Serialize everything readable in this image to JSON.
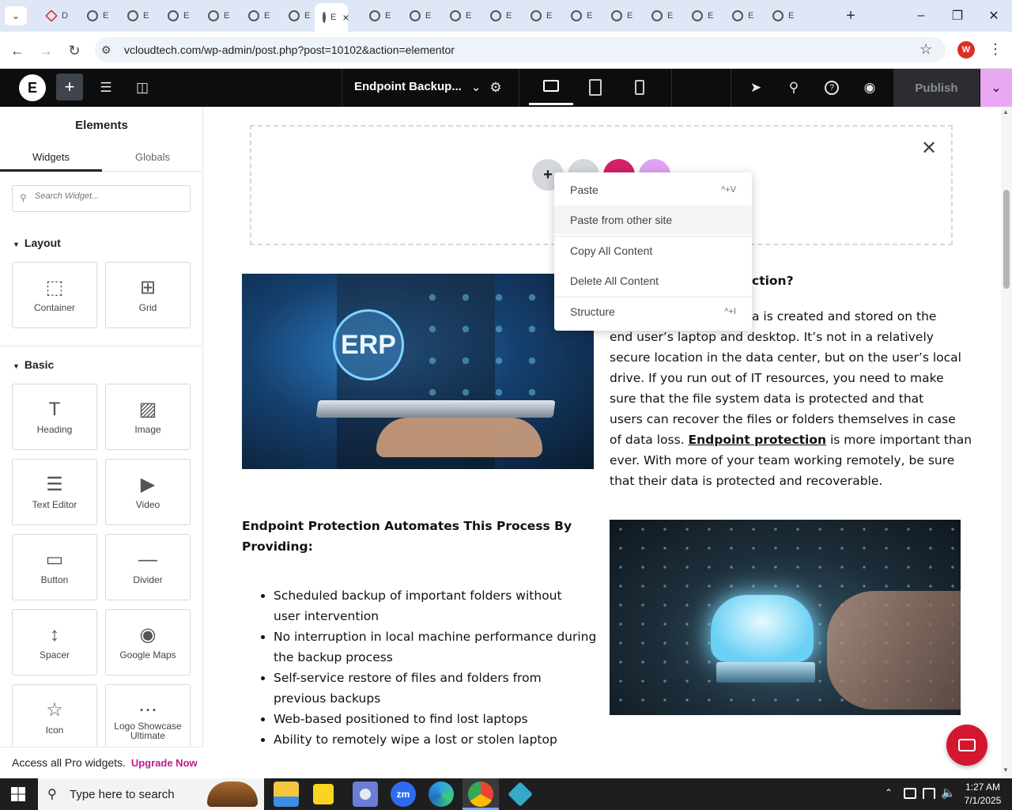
{
  "browser": {
    "tabs": [
      {
        "label": "D",
        "active": false
      },
      {
        "label": "E",
        "active": false
      },
      {
        "label": "E",
        "active": false
      },
      {
        "label": "E",
        "active": false
      },
      {
        "label": "E",
        "active": false
      },
      {
        "label": "E",
        "active": false
      },
      {
        "label": "E",
        "active": false
      },
      {
        "label": "E",
        "active": true
      },
      {
        "label": "E",
        "active": false
      },
      {
        "label": "E",
        "active": false
      },
      {
        "label": "E",
        "active": false
      },
      {
        "label": "E",
        "active": false
      },
      {
        "label": "E",
        "active": false
      },
      {
        "label": "E",
        "active": false
      },
      {
        "label": "E",
        "active": false
      },
      {
        "label": "E",
        "active": false
      },
      {
        "label": "E",
        "active": false
      },
      {
        "label": "E",
        "active": false
      },
      {
        "label": "E",
        "active": false
      }
    ],
    "url": "vcloudtech.com/wp-admin/post.php?post=10102&action=elementor",
    "profile_initial": "W",
    "profile_color": "#d93025"
  },
  "editor": {
    "page_title": "Endpoint Backup...",
    "publish_label": "Publish",
    "accent": "#e8a9f2"
  },
  "panel": {
    "title": "Elements",
    "tabs": [
      "Widgets",
      "Globals"
    ],
    "search_placeholder": "Search Widget...",
    "layout_heading": "Layout",
    "basic_heading": "Basic",
    "layout_widgets": [
      {
        "label": "Container",
        "icon": "container-icon"
      },
      {
        "label": "Grid",
        "icon": "grid-icon"
      }
    ],
    "basic_widgets": [
      {
        "label": "Heading",
        "icon": "heading-icon"
      },
      {
        "label": "Image",
        "icon": "image-icon"
      },
      {
        "label": "Text Editor",
        "icon": "text-editor-icon"
      },
      {
        "label": "Video",
        "icon": "video-icon"
      },
      {
        "label": "Button",
        "icon": "button-icon"
      },
      {
        "label": "Divider",
        "icon": "divider-icon"
      },
      {
        "label": "Spacer",
        "icon": "spacer-icon"
      },
      {
        "label": "Google Maps",
        "icon": "map-icon"
      },
      {
        "label": "Icon",
        "icon": "star-icon"
      },
      {
        "label": "Logo Showcase Ultimate",
        "icon": "logo-showcase-icon"
      }
    ],
    "promo_text": "Access all Pro widgets.",
    "promo_link": "Upgrade Now"
  },
  "context_menu": [
    {
      "label": "Paste",
      "shortcut": "^+V"
    },
    {
      "label": "Paste from other site",
      "shortcut": ""
    },
    {
      "label": "Copy All Content",
      "shortcut": ""
    },
    {
      "label": "Delete All Content",
      "shortcut": ""
    },
    {
      "label": "Structure",
      "shortcut": "^+I"
    }
  ],
  "content": {
    "heading_fragment": "ction?",
    "para_fragment_first": "a is created and stored on the",
    "para_lines": [
      "end user’s laptop and desktop. It’s not in a relatively",
      "secure location in the data center, but on the user’s local",
      "drive. If you run out of IT resources, you need to make",
      "sure that the file system data is protected and that",
      "users can recover the files or folders themselves in case"
    ],
    "para_line_pre": "of data loss.",
    "para_link": "Endpoint protection",
    "para_line_post": "is more important than",
    "para_last_lines": [
      "ever. With more of your team working remotely, be sure",
      "that their data is protected and recoverable."
    ],
    "image1_text": "ERP",
    "section2_heading_l1": "Endpoint Protection Automates This Process By",
    "section2_heading_l2": "Providing:",
    "bullets": [
      [
        "Scheduled backup of important folders without",
        "user intervention"
      ],
      [
        "No interruption in local machine performance during",
        "the backup process"
      ],
      [
        "Self-service restore of files and folders from",
        "previous backups"
      ],
      [
        "Web-based positioned to find lost laptops"
      ],
      [
        "Ability to remotely wipe a lost or stolen laptop"
      ]
    ]
  },
  "taskbar": {
    "search_placeholder": "Type here to search",
    "time": "1:27 AM",
    "date": "7/1/2025"
  }
}
